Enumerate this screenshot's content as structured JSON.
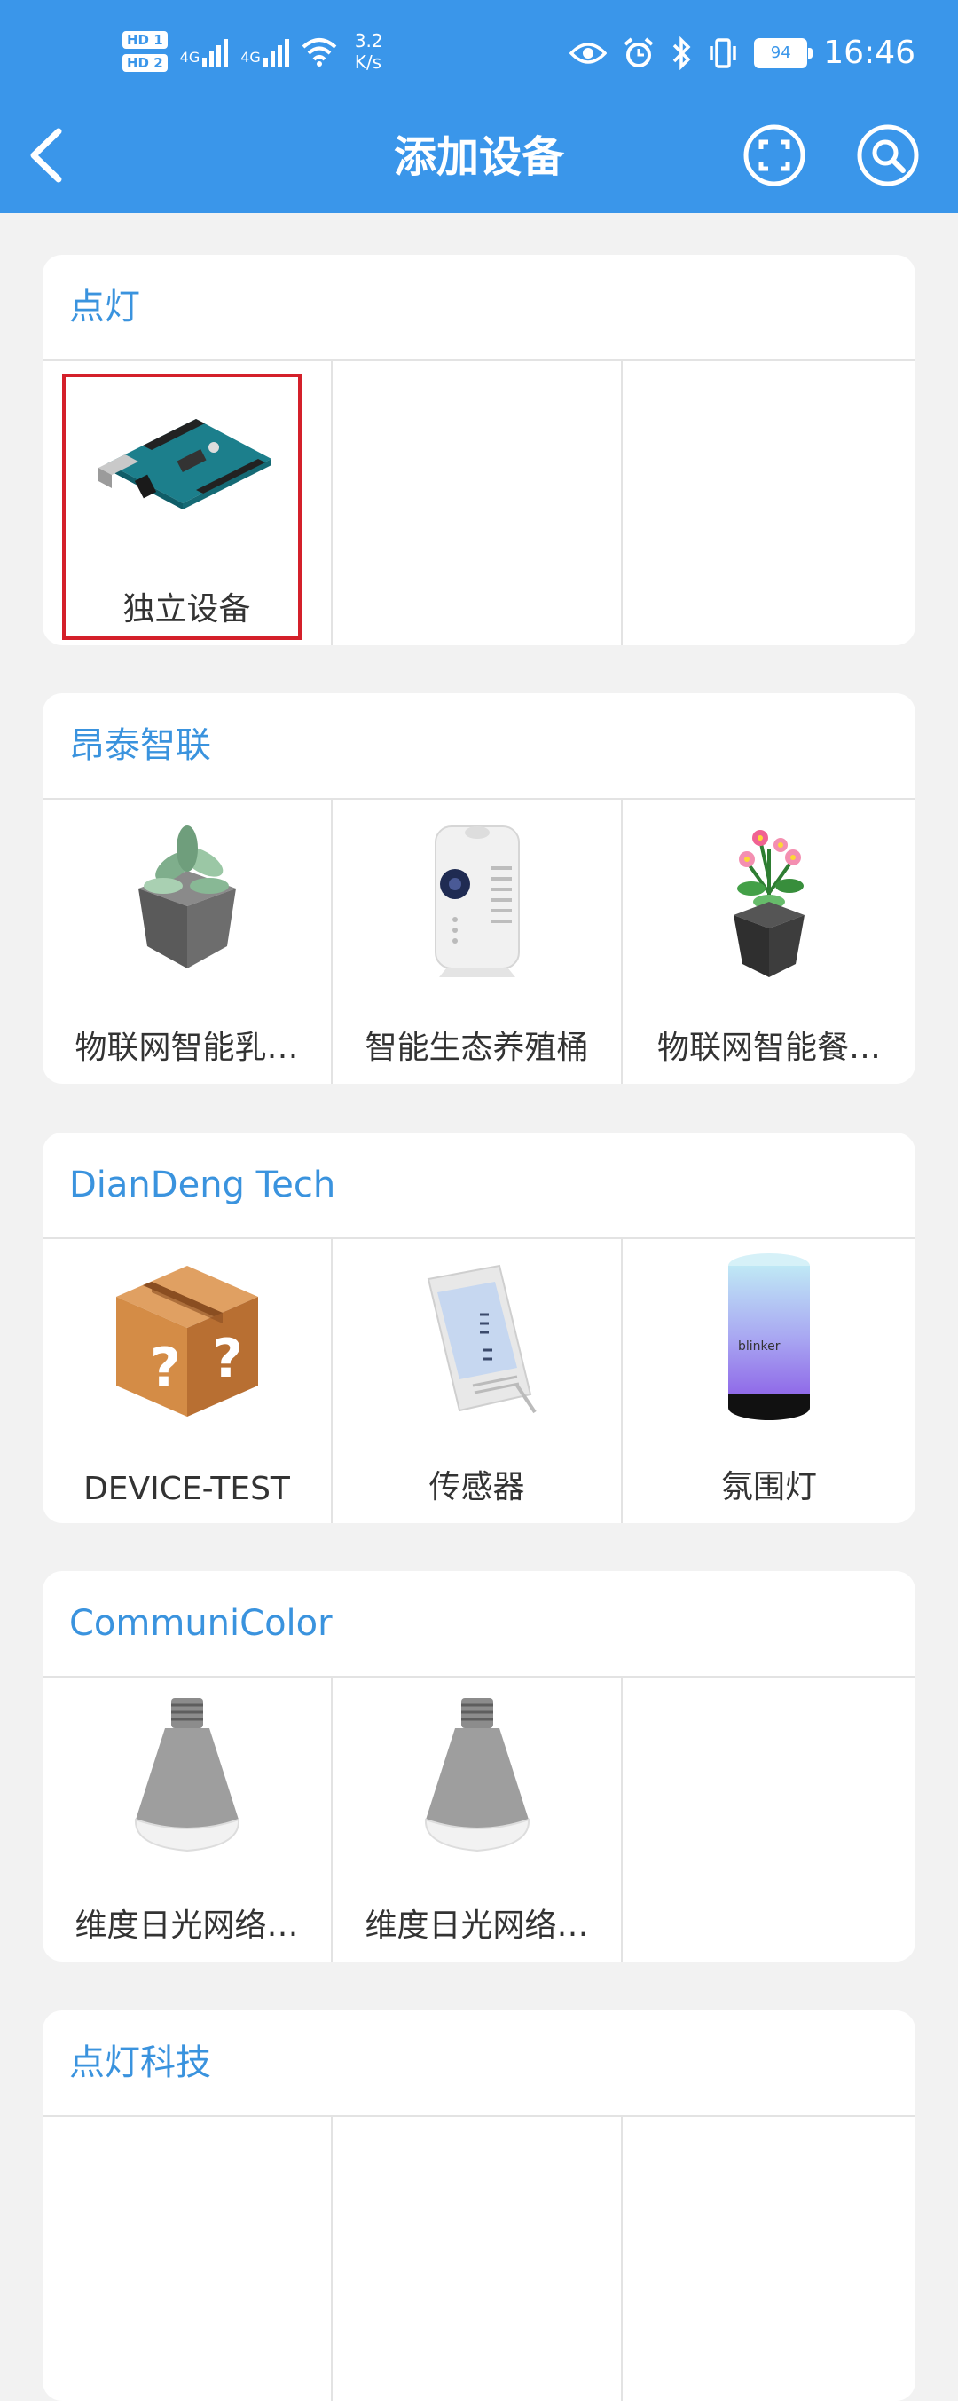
{
  "status_bar": {
    "hd1": "HD 1",
    "hd2": "HD 2",
    "net1": "4G",
    "net2": "4G",
    "speed_value": "3.2",
    "speed_unit": "K/s",
    "battery": "94",
    "time": "16:46"
  },
  "header": {
    "title": "添加设备",
    "icons": [
      "back-arrow-icon",
      "scan-icon",
      "search-icon"
    ]
  },
  "sections": [
    {
      "title": "点灯",
      "items": [
        {
          "label": "独立设备",
          "icon": "arduino-board-icon",
          "selected": true
        }
      ]
    },
    {
      "title": "昂泰智联",
      "items": [
        {
          "label": "物联网智能乳…",
          "icon": "succulent-pot-icon"
        },
        {
          "label": "智能生态养殖桶",
          "icon": "ecology-bucket-icon"
        },
        {
          "label": "物联网智能餐…",
          "icon": "flower-pot-icon"
        }
      ]
    },
    {
      "title": "DianDeng Tech",
      "items": [
        {
          "label": "DEVICE-TEST",
          "icon": "mystery-box-icon"
        },
        {
          "label": "传感器",
          "icon": "thermometer-sensor-icon"
        },
        {
          "label": "氛围灯",
          "icon": "ambient-lamp-icon"
        }
      ]
    },
    {
      "title": "CommuniColor",
      "items": [
        {
          "label": "维度日光网络…",
          "icon": "light-bulb-icon"
        },
        {
          "label": "维度日光网络…",
          "icon": "light-bulb-icon"
        }
      ]
    },
    {
      "title": "点灯科技",
      "items": []
    }
  ],
  "colors": {
    "header_bg": "#3a96ea",
    "section_title": "#3a93de",
    "selection_border": "#d4202a",
    "page_bg": "#f2f2f2"
  }
}
